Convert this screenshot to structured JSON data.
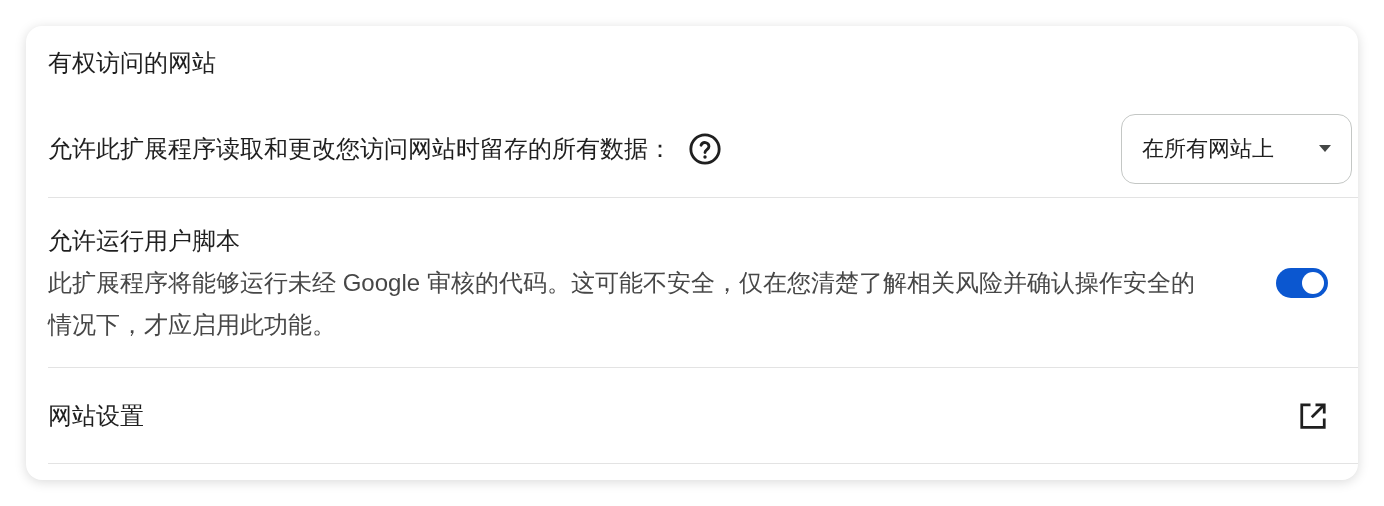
{
  "section": {
    "title": "有权访问的网站"
  },
  "rows": [
    {
      "kind": "select",
      "label": "允许此扩展程序读取和更改您访问网站时留存的所有数据：",
      "value": "在所有网站上"
    },
    {
      "kind": "toggle",
      "label": "允许运行用户脚本",
      "description": "此扩展程序将能够运行未经 Google 审核的代码。这可能不安全，仅在您清楚了解相关风险并确认操作安全的情况下，才应启用此功能。",
      "on": true
    },
    {
      "kind": "link",
      "label": "网站设置"
    }
  ]
}
